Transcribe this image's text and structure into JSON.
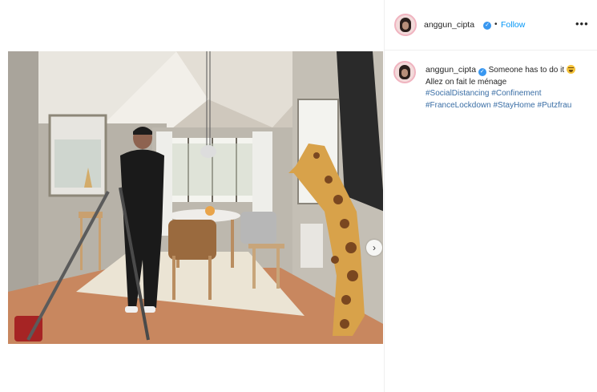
{
  "post": {
    "username": "anggun_cipta",
    "follow_label": "Follow",
    "separator": "•",
    "more_label": "•••",
    "verified_glyph": "✓"
  },
  "caption": {
    "username": "anggun_cipta",
    "text_part1": "Someone has to do it",
    "text_part2": "Allez on fait le ménage",
    "hashtags": [
      "#SocialDistancing",
      "#Confinement",
      "#FranceLockdown",
      "#StayHome",
      "#Putzfrau"
    ],
    "emoji": "grinning-sweat-emoji"
  },
  "photo": {
    "description_icon": "photo",
    "next_glyph": "›"
  },
  "colors": {
    "accent": "#0095f6",
    "hashtag": "#3a6ea5",
    "verified": "#3897f0"
  }
}
